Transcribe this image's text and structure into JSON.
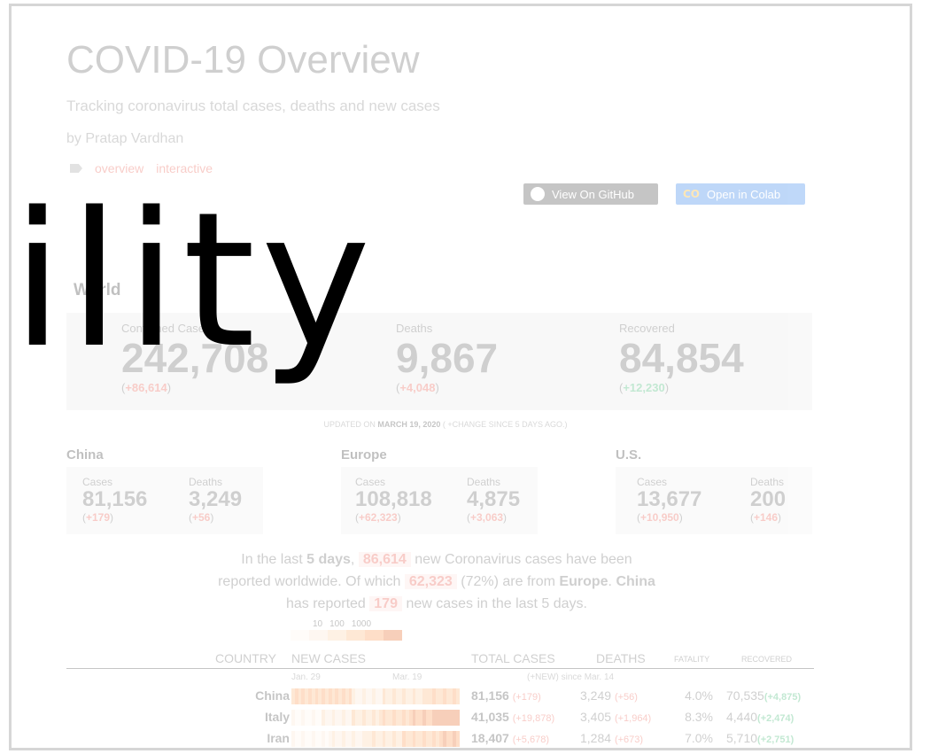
{
  "header": {
    "title": "COVID-19 Overview",
    "subtitle": "Tracking coronavirus total cases, deaths and new cases",
    "byline": "by Pratap Vardhan",
    "tags": [
      "overview",
      "interactive"
    ]
  },
  "buttons": {
    "github": "View On GitHub",
    "colab": "Open in Colab"
  },
  "world": {
    "label": "World",
    "confirmed_label": "Confirmed Cases",
    "confirmed": "242,708",
    "confirmed_change": "+86,614",
    "deaths_label": "Deaths",
    "deaths": "9,867",
    "deaths_change": "+4,048",
    "recovered_label": "Recovered",
    "recovered": "84,854",
    "recovered_change": "+12,230"
  },
  "updated": {
    "prefix": "UPDATED ON",
    "date": "MARCH 19, 2020",
    "suffix": "( +CHANGE SINCE 5 DAYS AGO.)"
  },
  "regions": [
    {
      "name": "China",
      "cases_label": "Cases",
      "cases": "81,156",
      "cases_change": "+179",
      "deaths_label": "Deaths",
      "deaths": "3,249",
      "deaths_change": "+56"
    },
    {
      "name": "Europe",
      "cases_label": "Cases",
      "cases": "108,818",
      "cases_change": "+62,323",
      "deaths_label": "Deaths",
      "deaths": "4,875",
      "deaths_change": "+3,063"
    },
    {
      "name": "U.S.",
      "cases_label": "Cases",
      "cases": "13,677",
      "cases_change": "+10,950",
      "deaths_label": "Deaths",
      "deaths": "200",
      "deaths_change": "+146"
    }
  ],
  "summary": {
    "t1": "In the last",
    "days": "5 days",
    "t2": ",",
    "new_cases": "86,614",
    "t3": "new Coronavirus cases have been reported worldwide. Of which",
    "europe_cases": "62,323",
    "t4": "(72%) are from",
    "europe": "Europe",
    "t5": ".",
    "china": "China",
    "t6": "has reported",
    "china_cases": "179",
    "t7": "new cases in the last 5 days."
  },
  "legend": {
    "ticks": [
      "10",
      "100",
      "1000"
    ]
  },
  "table": {
    "headers": {
      "country": "COUNTRY",
      "new_cases": "NEW CASES",
      "total_cases": "TOTAL CASES",
      "deaths": "DEATHS",
      "fatality": "FATALITY",
      "recovered": "RECOVERED"
    },
    "sub": {
      "start": "Jan. 29",
      "end": "Mar. 19",
      "since": "(+NEW) since Mar. 14"
    },
    "rows": [
      {
        "country": "China",
        "total": "81,156",
        "total_change": "(+179)",
        "deaths": "3,249",
        "deaths_change": "(+56)",
        "fatality": "4.0%",
        "recovered": "70,535",
        "recovered_change": "(+4,875)",
        "heat_level": 0.45
      },
      {
        "country": "Italy",
        "total": "41,035",
        "total_change": "(+19,878)",
        "deaths": "3,405",
        "deaths_change": "(+1,964)",
        "fatality": "8.3%",
        "recovered": "4,440",
        "recovered_change": "(+2,474)",
        "heat_level": 0.7
      },
      {
        "country": "Iran",
        "total": "18,407",
        "total_change": "(+5,678)",
        "deaths": "1,284",
        "deaths_change": "(+673)",
        "fatality": "7.0%",
        "recovered": "5,710",
        "recovered_change": "(+2,751)",
        "heat_level": 0.55
      }
    ]
  },
  "overlay": {
    "text": "ility"
  },
  "colors": {
    "accent_red": "#e74c3c",
    "accent_green": "#27ae60",
    "colab_blue": "#1a73e8",
    "github_dark": "#333333"
  }
}
